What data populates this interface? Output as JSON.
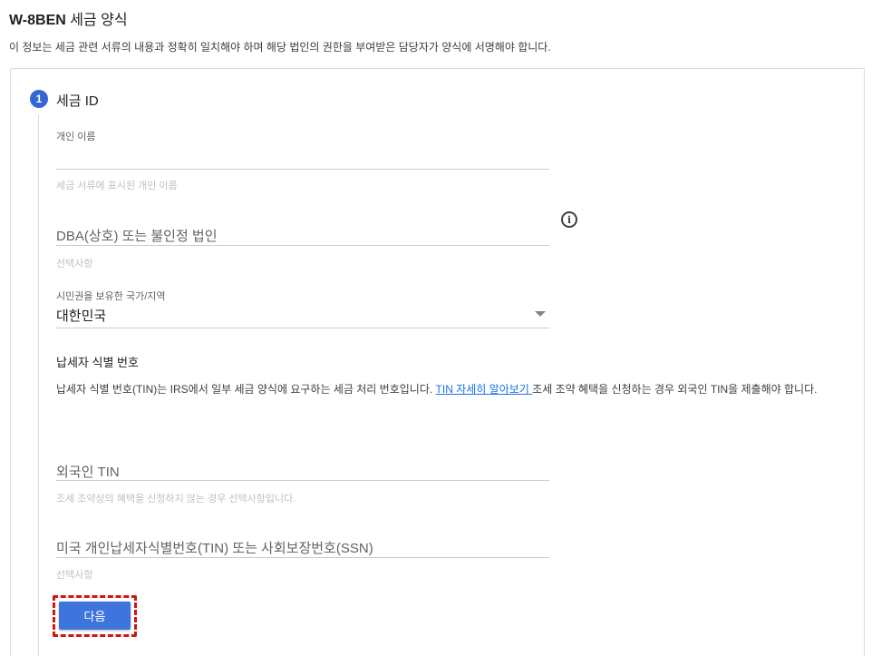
{
  "page": {
    "title_bold": "W-8BEN",
    "title_rest": " 세금 양식",
    "subtitle": "이 정보는 세금 관련 서류의 내용과 정확히 일치해야 하며 해당 법인의 권한을 부여받은 담당자가 양식에 서명해야 합니다."
  },
  "step": {
    "number": "1",
    "title": "세금 ID"
  },
  "fields": {
    "individual_name": {
      "label": "개인 이름",
      "value": "",
      "hint": "세금 서류에 표시된 개인 이름"
    },
    "dba": {
      "placeholder": "DBA(상호) 또는 불인정 법인",
      "hint": "선택사항"
    },
    "citizenship": {
      "label": "시민권을 보유한 국가/지역",
      "value": "대한민국"
    },
    "foreign_tin": {
      "placeholder": "외국인 TIN",
      "hint": "조세 조약상의 혜택을 신청하지 않는 경우 선택사항입니다."
    },
    "us_tin": {
      "placeholder": "미국 개인납세자식별번호(TIN) 또는 사회보장번호(SSN)",
      "hint": "선택사항"
    }
  },
  "tin_section": {
    "heading": "납세자 식별 번호",
    "desc_before": "납세자 식별 번호(TIN)는 IRS에서 일부 세금 양식에 요구하는 세금 처리 번호입니다. ",
    "link_text": "TIN 자세히 알아보기 ",
    "desc_after": "조세 조약 혜택을 신청하는 경우 외국인 TIN을 제출해야 합니다."
  },
  "buttons": {
    "next_label": "다음"
  },
  "icons": {
    "info": "info-icon",
    "dropdown": "chevron-down-icon"
  },
  "colors": {
    "accent": "#3367d6",
    "highlight_border": "#d01515"
  }
}
